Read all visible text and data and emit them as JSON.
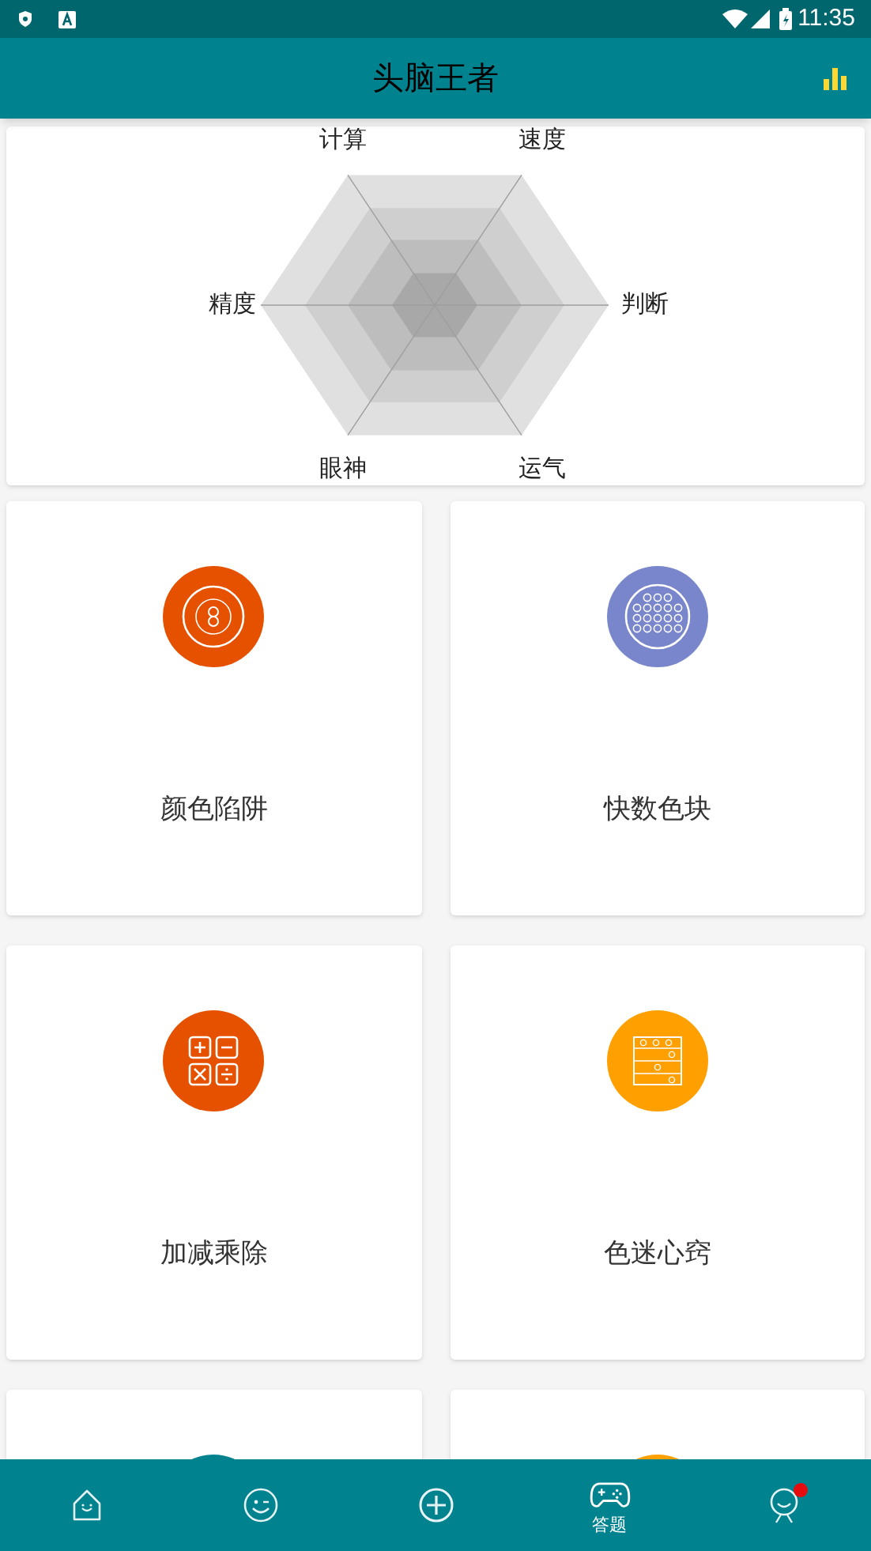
{
  "status_bar": {
    "time": "11:35"
  },
  "app_bar": {
    "title": "头脑王者"
  },
  "radar": {
    "axes": [
      "计算",
      "速度",
      "判断",
      "运气",
      "眼神",
      "精度"
    ]
  },
  "games": [
    {
      "label": "颜色陷阱",
      "kind": "rings",
      "color": "#e65100"
    },
    {
      "label": "快数色块",
      "kind": "dots",
      "color": "#7986cb"
    },
    {
      "label": "加减乘除",
      "kind": "math",
      "color": "#e65100"
    },
    {
      "label": "色迷心窍",
      "kind": "grid",
      "color": "#ffa000"
    },
    {
      "kind": "none",
      "color": "#00838f"
    },
    {
      "kind": "none",
      "color": "#ffa000"
    }
  ],
  "bottom_nav": [
    {
      "kind": "home",
      "selected": false
    },
    {
      "kind": "wink",
      "selected": false
    },
    {
      "kind": "plus",
      "selected": false
    },
    {
      "kind": "gamepad",
      "label": "答题",
      "selected": true
    },
    {
      "kind": "person",
      "selected": false,
      "notification": true
    }
  ]
}
